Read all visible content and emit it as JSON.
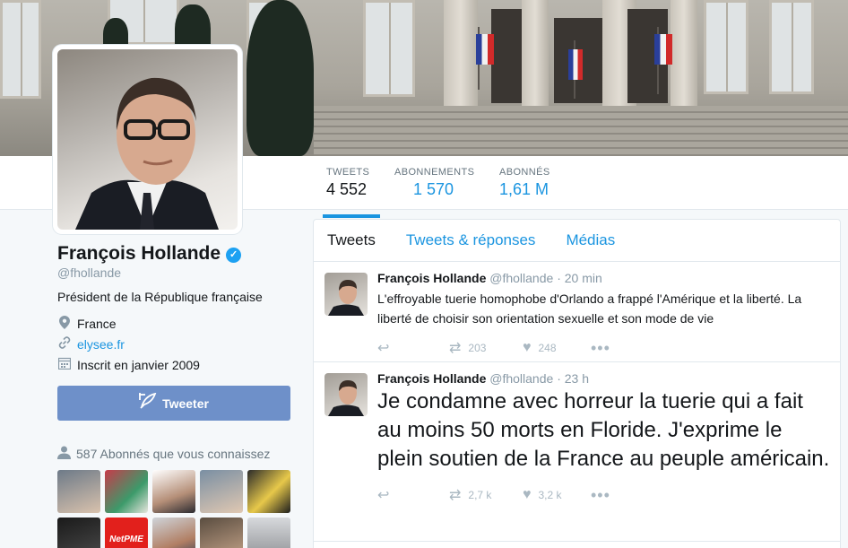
{
  "profile": {
    "name": "François Hollande",
    "handle": "@fhollande",
    "bio": "Président de la République française",
    "location": "France",
    "website": "elysee.fr",
    "joined": "Inscrit en janvier 2009",
    "tweet_button": "Tweeter",
    "followers_you_know": "587 Abonnés que vous connaissez"
  },
  "stats": [
    {
      "label": "TWEETS",
      "value": "4 552"
    },
    {
      "label": "ABONNEMENTS",
      "value": "1 570"
    },
    {
      "label": "ABONNÉS",
      "value": "1,61 M"
    }
  ],
  "tabs": [
    "Tweets",
    "Tweets & réponses",
    "Médias"
  ],
  "tweets": [
    {
      "name": "François Hollande",
      "handle": "@fhollande",
      "time": "20 min",
      "text": "L'effroyable tuerie homophobe d'Orlando a frappé l'Amérique et la liberté. La liberté de choisir son orientation sexuelle et son mode de vie",
      "retweets": "203",
      "likes": "248"
    },
    {
      "name": "François Hollande",
      "handle": "@fhollande",
      "time": "23 h",
      "text": "Je condamne avec horreur la tuerie qui a fait au moins 50 morts en Floride. J'exprime le plein soutien de la France au peuple américain.",
      "retweets": "2,7 k",
      "likes": "3,2 k"
    }
  ],
  "thumb_labels": {
    "netpme": "NetPME"
  },
  "colors": {
    "accent": "#1b95e0",
    "button": "#6e90c9",
    "verified": "#1da1f2"
  }
}
